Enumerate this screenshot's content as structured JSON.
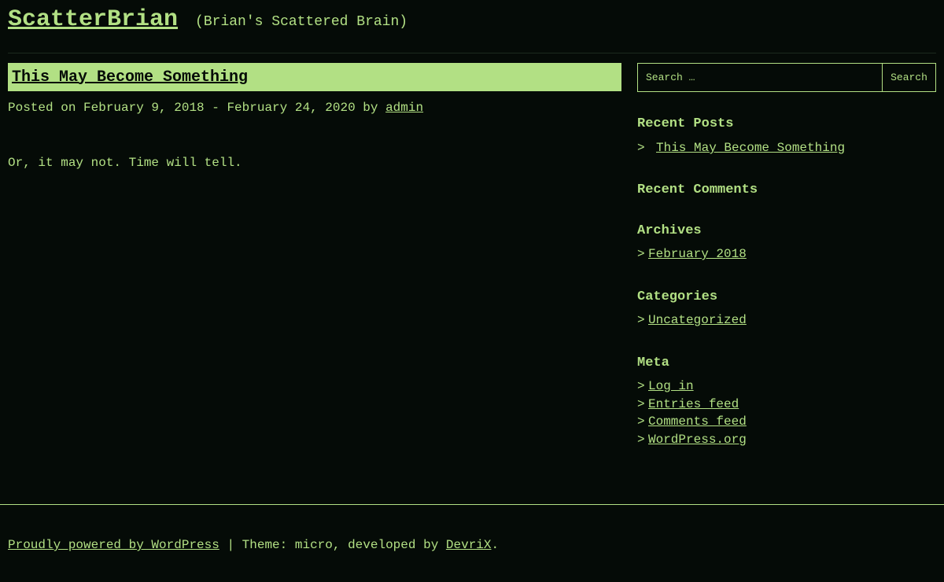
{
  "site": {
    "title": "ScatterBrian",
    "description": "(Brian's Scattered Brain)"
  },
  "post": {
    "title": "This May Become Something",
    "meta_prefix": "Posted on February 9, 2018 - February 24, 2020 by ",
    "author": "admin",
    "content": "Or, it may not. Time will tell."
  },
  "sidebar": {
    "search": {
      "placeholder": "Search …",
      "button_label": "Search"
    },
    "recent_posts": {
      "title": "Recent Posts",
      "items": [
        "This May Become Something"
      ]
    },
    "recent_comments": {
      "title": "Recent Comments"
    },
    "archives": {
      "title": "Archives",
      "items": [
        "February 2018"
      ]
    },
    "categories": {
      "title": "Categories",
      "items": [
        "Uncategorized"
      ]
    },
    "meta": {
      "title": "Meta",
      "items": [
        "Log in",
        "Entries feed",
        "Comments feed",
        "WordPress.org"
      ]
    },
    "bullet": ">"
  },
  "footer": {
    "powered_by": "Proudly powered by WordPress",
    "separator_text": " | Theme: micro, developed by ",
    "theme_author": "DevriX",
    "end": "."
  },
  "colors": {
    "background": "#050b07",
    "accent": "#b2e084"
  }
}
